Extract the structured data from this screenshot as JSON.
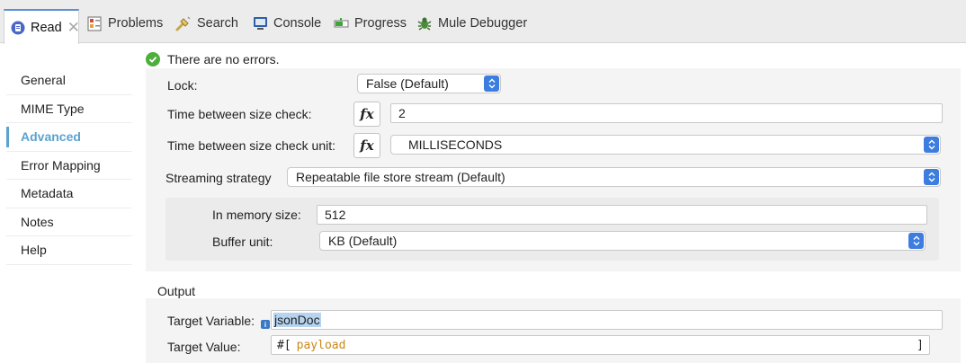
{
  "tabs": [
    {
      "label": "Read",
      "icon": "read-file-icon",
      "active": true,
      "close": "✕"
    },
    {
      "label": "Problems",
      "icon": "problems-icon"
    },
    {
      "label": "Search",
      "icon": "search-flashlight-icon"
    },
    {
      "label": "Console",
      "icon": "console-icon"
    },
    {
      "label": "Progress",
      "icon": "progress-icon"
    },
    {
      "label": "Mule Debugger",
      "icon": "bug-icon"
    }
  ],
  "sidebar": {
    "items": [
      {
        "label": "General"
      },
      {
        "label": "MIME Type"
      },
      {
        "label": "Advanced",
        "active": true
      },
      {
        "label": "Error Mapping"
      },
      {
        "label": "Metadata"
      },
      {
        "label": "Notes"
      },
      {
        "label": "Help"
      }
    ]
  },
  "status": {
    "message": "There are no errors.",
    "color": "#4cae3b"
  },
  "form": {
    "lock": {
      "label": "Lock:",
      "value": "False (Default)"
    },
    "size_check": {
      "label": "Time between size check:",
      "fx": "fx",
      "value": "2"
    },
    "size_check_unit": {
      "label": "Time between size check unit:",
      "fx": "fx",
      "value": "MILLISECONDS"
    },
    "streaming": {
      "label": "Streaming strategy",
      "value": "Repeatable file store stream (Default)"
    },
    "memory_size": {
      "label": "In memory size:",
      "value": "512"
    },
    "buffer_unit": {
      "label": "Buffer unit:",
      "value": "KB (Default)"
    }
  },
  "output": {
    "title": "Output",
    "target_variable": {
      "label": "Target Variable:",
      "info": "i",
      "value": "jsonDoc"
    },
    "target_value": {
      "label": "Target Value:",
      "open": "#[",
      "keyword": "payload",
      "close": "]"
    }
  },
  "colors": {
    "accent": "#5aa3d0",
    "select_button": "#3d7de0",
    "keyword": "#c9891a"
  }
}
